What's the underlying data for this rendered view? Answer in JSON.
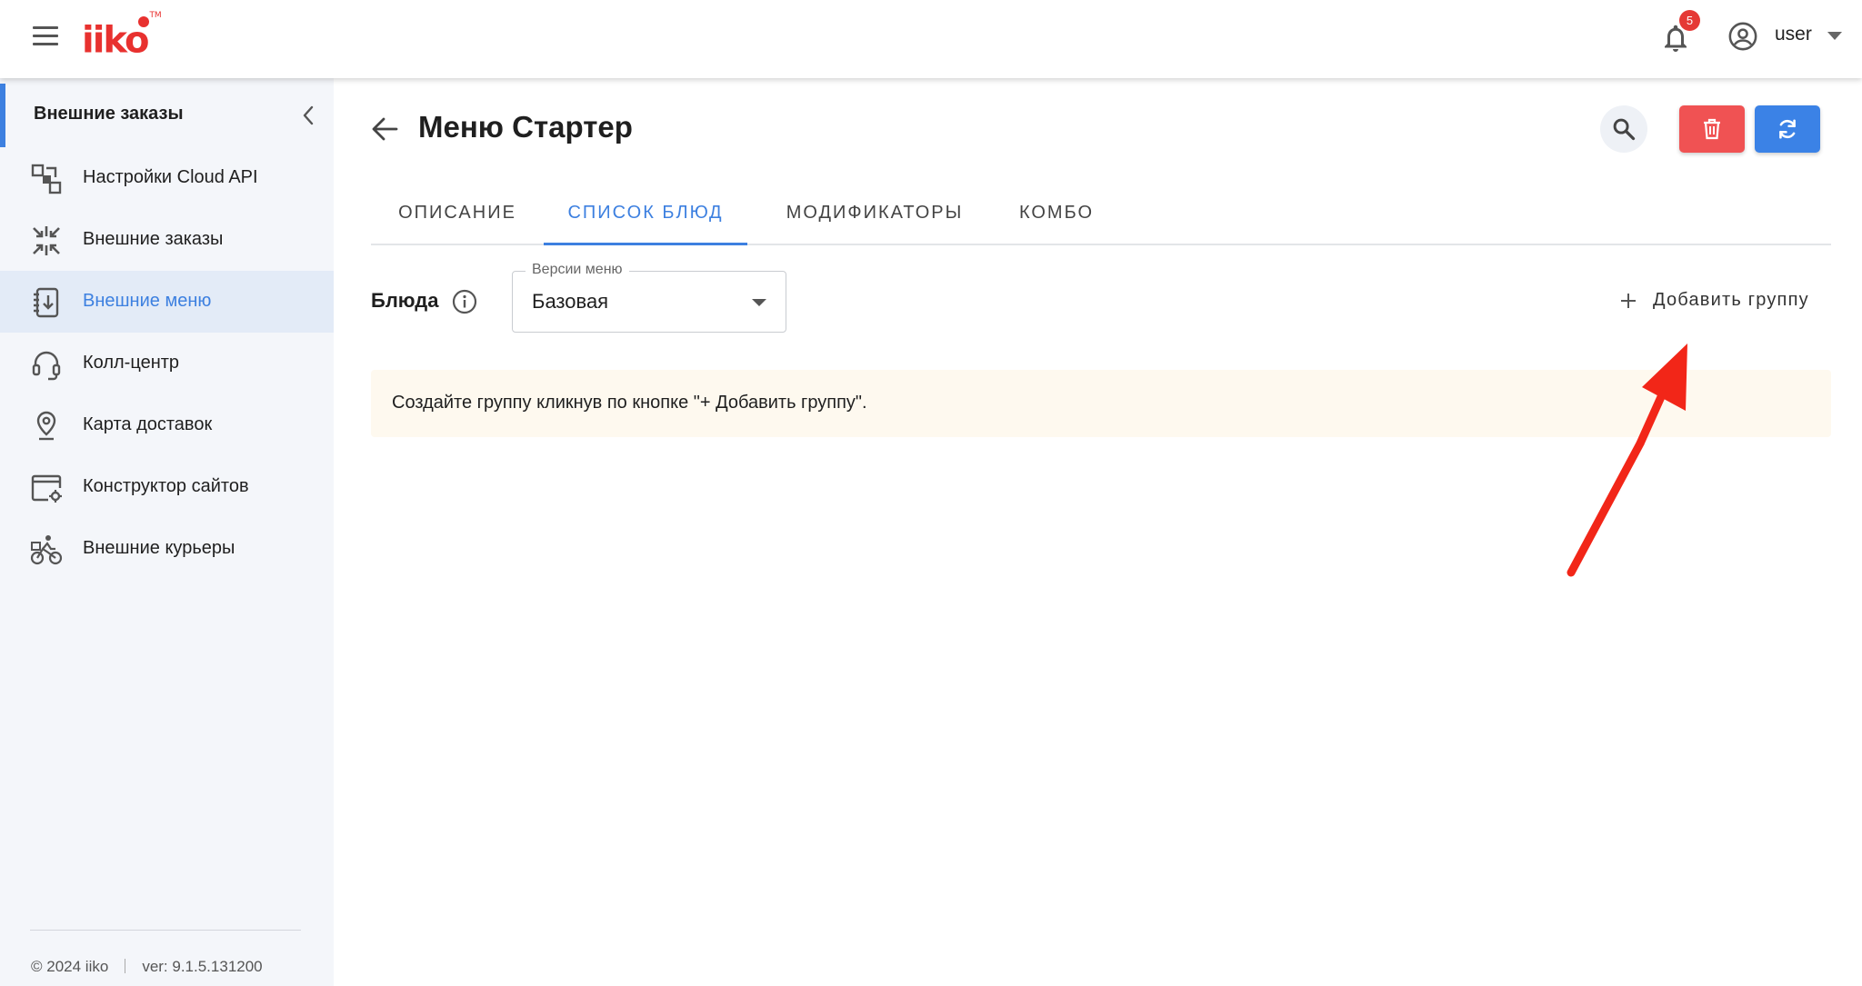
{
  "app": {
    "logo_text": "iiko",
    "logo_tm": "TM",
    "notifications_count": "5",
    "user_name": "user",
    "brand_color": "#e8312f",
    "accent_color": "#3d80e0"
  },
  "sidebar": {
    "header_title": "Внешние заказы",
    "items": [
      {
        "label": "Настройки Cloud API",
        "icon": "cloud-api-settings-icon",
        "active": false
      },
      {
        "label": "Внешние заказы",
        "icon": "external-orders-icon",
        "active": false
      },
      {
        "label": "Внешние меню",
        "icon": "external-menu-icon",
        "active": true
      },
      {
        "label": "Колл-центр",
        "icon": "headset-icon",
        "active": false
      },
      {
        "label": "Карта доставок",
        "icon": "map-pin-icon",
        "active": false
      },
      {
        "label": "Конструктор сайтов",
        "icon": "site-builder-icon",
        "active": false
      },
      {
        "label": "Внешние курьеры",
        "icon": "bicycle-courier-icon",
        "active": false
      }
    ],
    "footer_copyright": "© 2024 iiko",
    "footer_version": "ver: 9.1.5.131200"
  },
  "main": {
    "title": "Меню Стартер",
    "tabs": [
      {
        "label": "ОПИСАНИЕ",
        "active": false
      },
      {
        "label": "СПИСОК БЛЮД",
        "active": true
      },
      {
        "label": "МОДИФИКАТОРЫ",
        "active": false
      },
      {
        "label": "КОМБО",
        "active": false
      }
    ],
    "dishes_label": "Блюда",
    "menu_version": {
      "legend": "Версии меню",
      "value": "Базовая"
    },
    "add_group_label": "Добавить группу",
    "notice_text": "Создайте группу кликнув по кнопке \"+ Добавить группу\"."
  }
}
